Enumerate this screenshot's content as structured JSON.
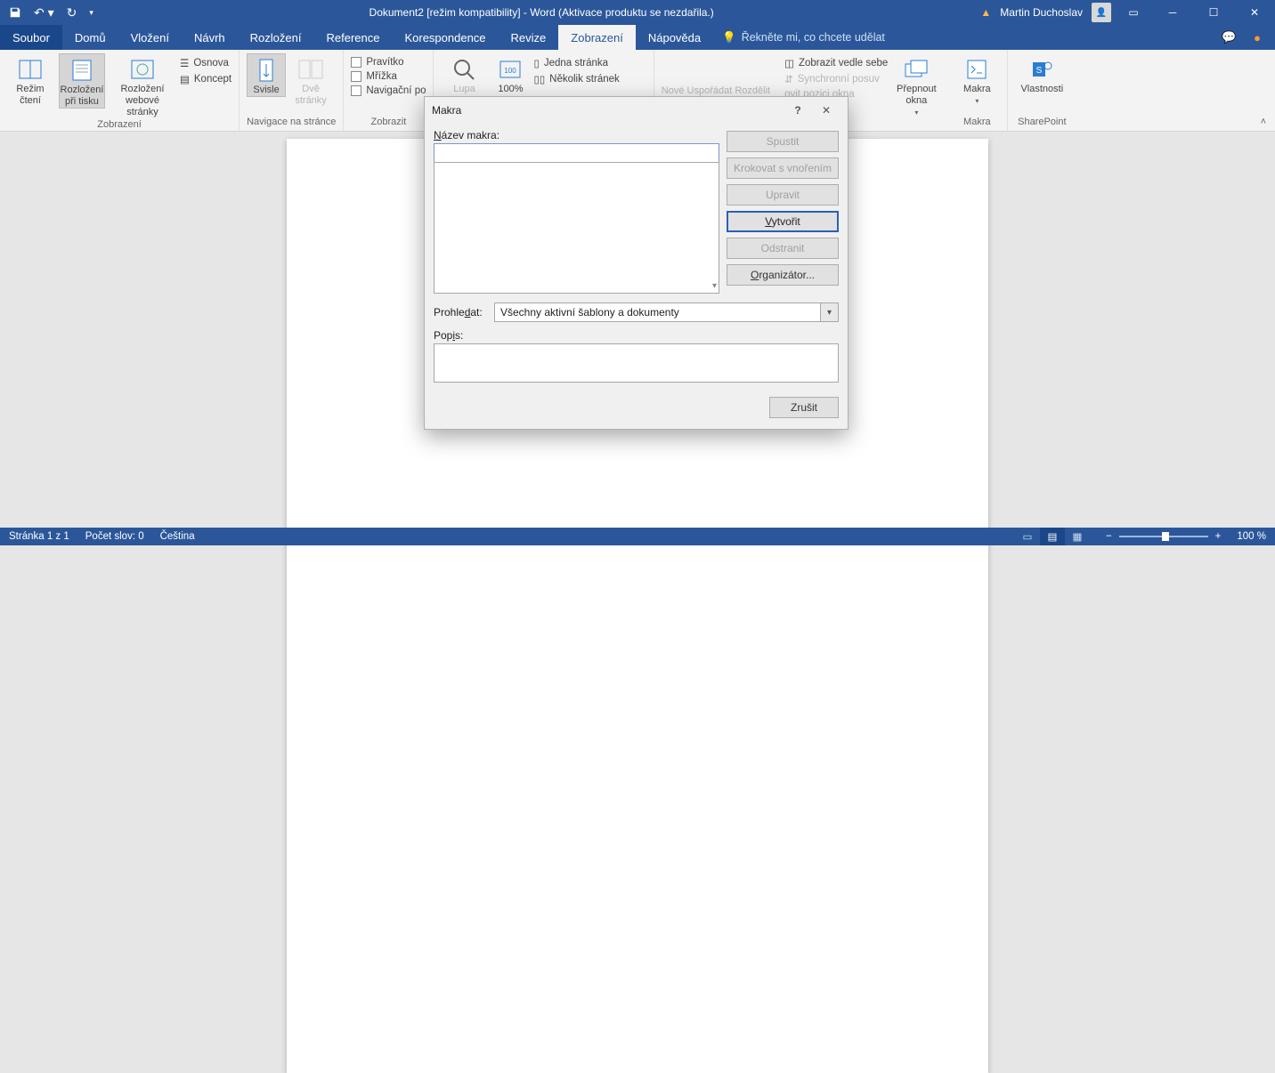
{
  "titlebar": {
    "title": "Dokument2 [režim kompatibility] - Word (Aktivace produktu se nezdařila.)",
    "user": "Martin Duchoslav"
  },
  "tabs": {
    "file": "Soubor",
    "items": [
      "Domů",
      "Vložení",
      "Návrh",
      "Rozložení",
      "Reference",
      "Korespondence",
      "Revize",
      "Zobrazení",
      "Nápověda"
    ],
    "active_index": 7,
    "tell_me": "Řekněte mi, co chcete udělat"
  },
  "ribbon": {
    "views": {
      "reading": "Režim\nčtení",
      "print_layout": "Rozložení\npři tisku",
      "web_layout": "Rozložení\nwebové stránky",
      "outline": "Osnova",
      "draft": "Koncept",
      "group_label": "Zobrazení"
    },
    "page_nav": {
      "vertical": "Svisle",
      "two_pages": "Dvě\nstránky",
      "group_label": "Navigace na stránce"
    },
    "show": {
      "ruler": "Pravítko",
      "gridlines": "Mřížka",
      "nav_pane": "Navigační po",
      "group_label": "Zobrazit"
    },
    "zoom": {
      "zoom": "Lupa",
      "hundred": "100%",
      "one_page": "Jedna stránka",
      "multi_pages": "Několik stránek"
    },
    "window": {
      "new_window_partial": "Nové  Uspořádat  Rozdělit",
      "side_by_side": "Zobrazit vedle sebe",
      "sync_scroll": "Synchronní posuv",
      "reset_pos": "ovit pozici okna",
      "switch": "Přepnout\nokna"
    },
    "macros": {
      "btn": "Makra",
      "group": "Makra"
    },
    "sharepoint": {
      "btn": "Vlastnosti",
      "group": "SharePoint"
    }
  },
  "dialog": {
    "title": "Makra",
    "name_label": "Název makra:",
    "name_value": "",
    "buttons": {
      "run": "Spustit",
      "step": "Krokovat s vnořením",
      "edit": "Upravit",
      "create": "Vytvořit",
      "delete": "Odstranit",
      "organizer": "Organizátor..."
    },
    "lookin_label": "Prohledat:",
    "lookin_value": "Všechny aktivní šablony a dokumenty",
    "desc_label": "Popis:",
    "cancel": "Zrušit"
  },
  "statusbar": {
    "page": "Stránka 1 z 1",
    "words": "Počet slov: 0",
    "lang": "Čeština",
    "zoom": "100 %"
  }
}
